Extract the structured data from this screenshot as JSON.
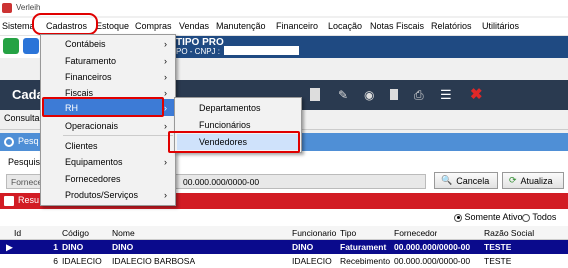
{
  "window": {
    "title": "Verleih"
  },
  "menu_bar": [
    "Sistema",
    "Cadastros",
    "Estoque",
    "Compras",
    "Vendas",
    "Manutenção",
    "Financeiro",
    "Locação",
    "Notas Fiscais",
    "Relatórios",
    "Utilitários"
  ],
  "company": {
    "name": "TIPO PRO",
    "cnpj_label": "PO - CNPJ :"
  },
  "screen_title": "Cada",
  "tab": "Consultar",
  "search": {
    "section": "Pesq",
    "label": "Pesquisa",
    "field_label": "Fornece",
    "value": "00.000.000/0000-00"
  },
  "buttons": {
    "cancel": "Cancela",
    "refresh": "Atualiza"
  },
  "results": {
    "label": "Resu"
  },
  "filters": {
    "active_only": "Somente Ativo",
    "all": "Todos",
    "selected": "active_only"
  },
  "cadastros_menu": [
    "Contábeis",
    "Faturamento",
    "Financeiros",
    "Fiscais",
    "RH",
    "Operacionais",
    "Clientes",
    "Equipamentos",
    "Fornecedores",
    "Produtos/Serviços"
  ],
  "rh_submenu": [
    "Departamentos",
    "Funcionários",
    "Vendedores"
  ],
  "table": {
    "columns": [
      "Id",
      "Código",
      "Nome",
      "Funcionario",
      "Tipo",
      "Fornecedor",
      "Razão Social"
    ],
    "rows": [
      [
        "1",
        "DINO",
        "DINO",
        "DINO",
        "Faturament",
        "00.000.000/0000-00",
        "TESTE"
      ],
      [
        "6",
        "IDALECIO",
        "IDALECIO BARBOSA",
        "IDALECIO",
        "Recebimento",
        "00.000.000/0000-00",
        "TESTE"
      ]
    ]
  },
  "colors": {
    "header_blue": "#1f4a82",
    "search_blue": "#4f8fd6",
    "results_red": "#d21c24",
    "selected_row": "#0a0a8c",
    "highlight": "#e00000"
  }
}
